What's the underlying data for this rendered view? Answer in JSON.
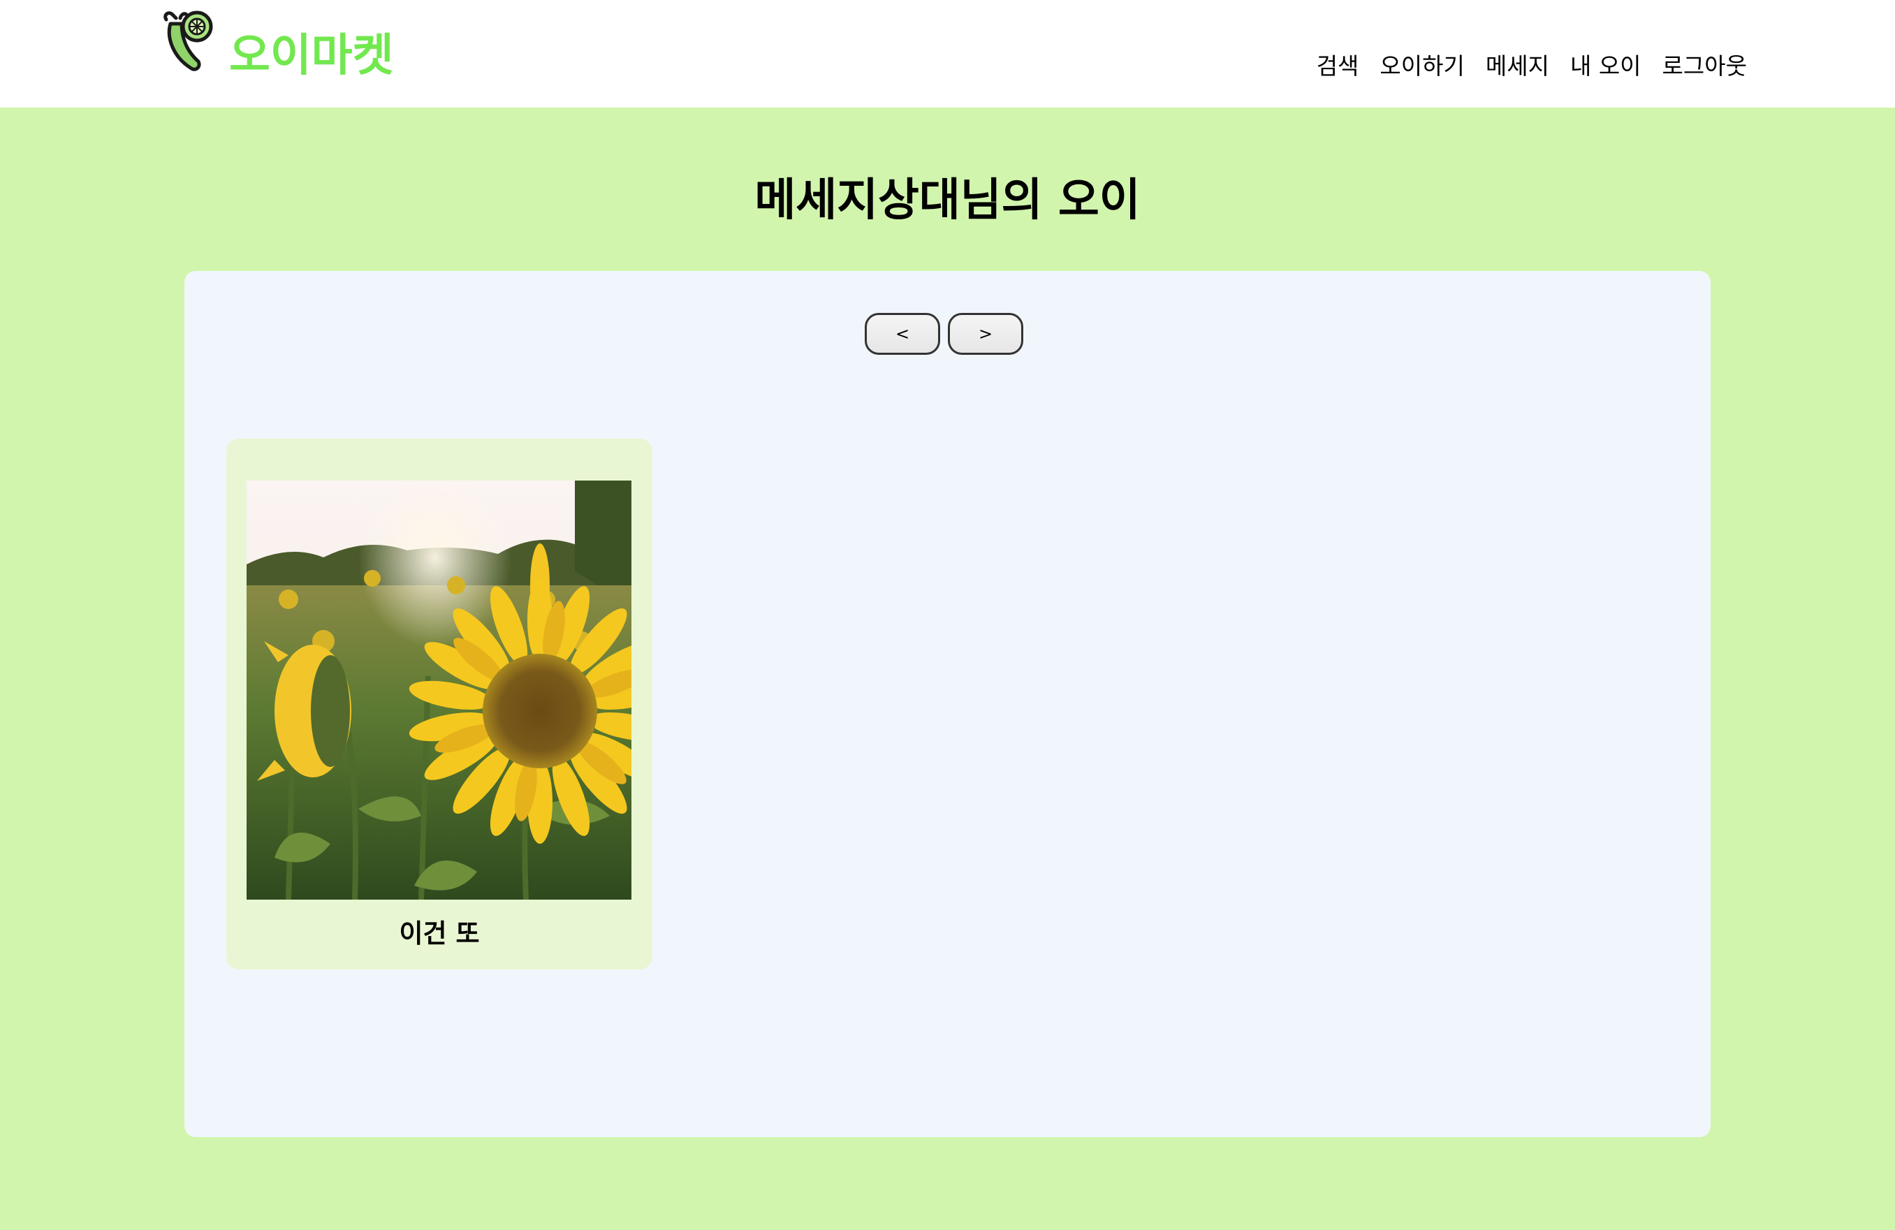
{
  "header": {
    "logo_text": "오이마켓",
    "logo_icon": "cucumber-icon",
    "logo_color": "#72e84f",
    "nav": [
      {
        "label": "검색"
      },
      {
        "label": "오이하기"
      },
      {
        "label": "메세지"
      },
      {
        "label": "내 오이"
      },
      {
        "label": "로그아웃"
      }
    ]
  },
  "page": {
    "title": "메세지상대님의 오이",
    "background": "#d1f5ad"
  },
  "pager": {
    "prev_label": "<",
    "next_label": ">"
  },
  "items": [
    {
      "title": "이건 또",
      "image": "sunflower-field-photo"
    }
  ]
}
